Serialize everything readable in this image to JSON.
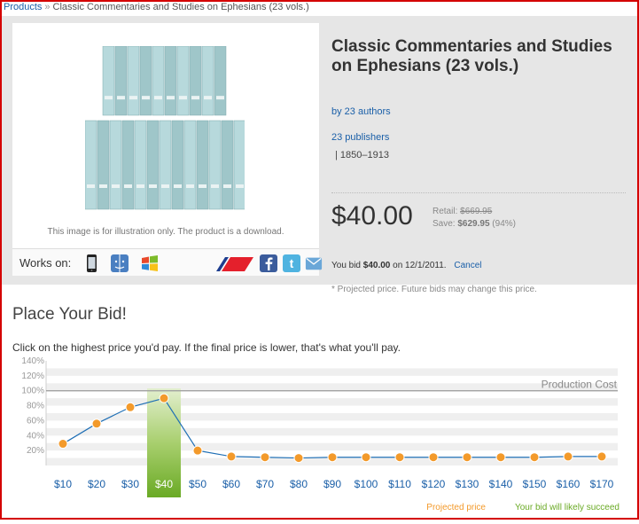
{
  "breadcrumb": {
    "root": "Products",
    "separator": "»",
    "current": "Classic Commentaries and Studies on Ephesians (23 vols.)"
  },
  "product": {
    "title_line1": "Classic Commentaries and Studies",
    "title_line2": "on Ephesians (23 vols.)",
    "authors": "by 23 authors",
    "publishers": "23 publishers",
    "years": "|  1850–1913",
    "image_caption": "This image is for illustration only. The product is a download.",
    "works_on_label": "Works on:"
  },
  "pricing": {
    "price": "$40.00",
    "retail_label": "Retail:",
    "retail_value": "$669.95",
    "save_label": "Save:",
    "save_value": "$629.95",
    "save_pct": "(94%)"
  },
  "bid_status": {
    "prefix": "You bid",
    "amount": "$40.00",
    "date_text": "on 12/1/2011.",
    "cancel": "Cancel",
    "note": "* Projected price. Future bids may change this price."
  },
  "icons": [
    "phone-icon",
    "mac-finder-icon",
    "windows-icon",
    "airline-logo-icon",
    "facebook-icon",
    "twitter-icon",
    "email-icon"
  ],
  "bid_section": {
    "title": "Place Your Bid!",
    "instructions": "Click on the highest price you'd pay. If the final price is lower, that's what you'll pay."
  },
  "colors": {
    "accent_orange": "#f39a2b",
    "line_blue": "#1f6fb5",
    "bid_green": "#6aaa25",
    "link_blue": "#1a5fa8",
    "frame_red": "#d40000"
  },
  "chart_data": {
    "type": "line",
    "categories": [
      "$10",
      "$20",
      "$30",
      "$40",
      "$50",
      "$60",
      "$70",
      "$80",
      "$90",
      "$100",
      "$110",
      "$120",
      "$130",
      "$140",
      "$150",
      "$160",
      "$170"
    ],
    "values": [
      29,
      56,
      78,
      90,
      20,
      12,
      11,
      10,
      11,
      11,
      11,
      11,
      11,
      11,
      11,
      12,
      12
    ],
    "y_ticks": [
      "140%",
      "120%",
      "100%",
      "80%",
      "60%",
      "40%",
      "20%"
    ],
    "y_tick_values": [
      140,
      120,
      100,
      80,
      60,
      40,
      20
    ],
    "ylim": [
      0,
      140
    ],
    "reference_line": {
      "value": 100,
      "label": "Production Cost"
    },
    "selected_category": "$40",
    "legend": {
      "projected": "Projected price",
      "succeed": "Your bid will likely succeed"
    }
  }
}
